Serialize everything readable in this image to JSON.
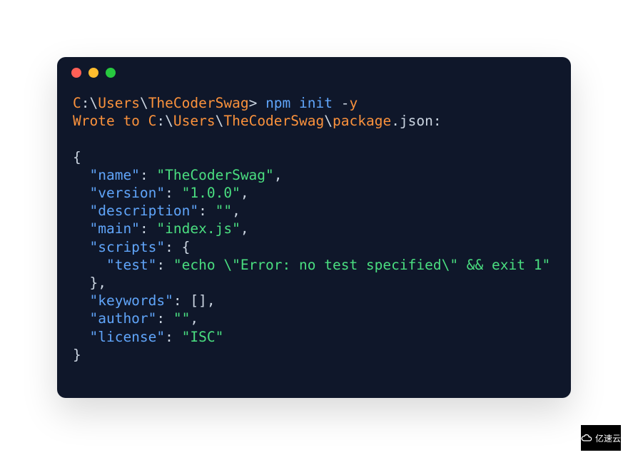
{
  "prompt": {
    "drive": "C",
    "sep": ":\\",
    "user_dir": "Users",
    "user": "TheCoderSwag",
    "marker": "> ",
    "cmd1": "npm",
    "cmd2": "init",
    "dash": " -",
    "flag": "y"
  },
  "wrote": {
    "prefix": "Wrote to ",
    "drive": "C",
    "sep": ":\\",
    "user_dir": "Users",
    "user": "TheCoderSwag",
    "slash": "\\",
    "file": "package",
    "suffix": ".json:"
  },
  "json_output": {
    "brace_open": "{",
    "brace_close": "}",
    "comma": ",",
    "colon": ": ",
    "bracket_empty": "[]",
    "brace_inner_open": "{",
    "brace_inner_close": "}",
    "indent1": "  ",
    "indent2": "    ",
    "keys": {
      "name": "\"name\"",
      "version": "\"version\"",
      "description": "\"description\"",
      "main": "\"main\"",
      "scripts": "\"scripts\"",
      "test": "\"test\"",
      "keywords": "\"keywords\"",
      "author": "\"author\"",
      "license": "\"license\""
    },
    "values": {
      "name": "\"TheCoderSwag\"",
      "version": "\"1.0.0\"",
      "description": "\"\"",
      "main": "\"index.js\"",
      "test": "\"echo \\\"Error: no test specified\\\" && exit 1\"",
      "author": "\"\"",
      "license": "\"ISC\""
    }
  },
  "watermark": {
    "text": "亿速云"
  }
}
